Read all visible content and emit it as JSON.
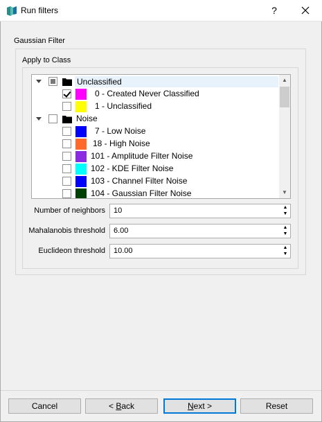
{
  "window": {
    "title": "Run filters",
    "help_label": "?",
    "close_label": "✕"
  },
  "filter": {
    "section_title": "Gaussian Filter",
    "apply_label": "Apply to Class"
  },
  "tree": {
    "rows": [
      {
        "label": "Unclassified",
        "kind": "group",
        "check": "partial",
        "selected": true
      },
      {
        "label": "0 - Created Never Classified",
        "kind": "item",
        "check": "checked",
        "color": "#ff00ff"
      },
      {
        "label": "1 - Unclassified",
        "kind": "item",
        "check": "unchecked",
        "color": "#ffff00"
      },
      {
        "label": "Noise",
        "kind": "group",
        "check": "unchecked"
      },
      {
        "label": "7 - Low Noise",
        "kind": "item",
        "check": "unchecked",
        "color": "#0000ff"
      },
      {
        "label": "18 - High Noise",
        "kind": "item",
        "check": "unchecked",
        "color": "#ff6a2a"
      },
      {
        "label": "101 - Amplitude Filter Noise",
        "kind": "item",
        "check": "unchecked",
        "color": "#8a2be2"
      },
      {
        "label": "102 - KDE Filter Noise",
        "kind": "item",
        "check": "unchecked",
        "color": "#00ffff"
      },
      {
        "label": "103 - Channel Filter Noise",
        "kind": "item",
        "check": "unchecked",
        "color": "#0000ff"
      },
      {
        "label": "104 - Gaussian Filter Noise",
        "kind": "item",
        "check": "unchecked",
        "color": "#004000"
      }
    ]
  },
  "params": {
    "neighbors_label": "Number of neighbors",
    "neighbors_value": "10",
    "mahalanobis_label": "Mahalanobis threshold",
    "mahalanobis_value": "6.00",
    "euclidean_label": "Euclideon threshold",
    "euclidean_value": "10.00"
  },
  "footer": {
    "cancel": "Cancel",
    "back_prefix": "< ",
    "back_key": "B",
    "back_rest": "ack",
    "next_key": "N",
    "next_rest": "ext >",
    "reset": "Reset"
  }
}
